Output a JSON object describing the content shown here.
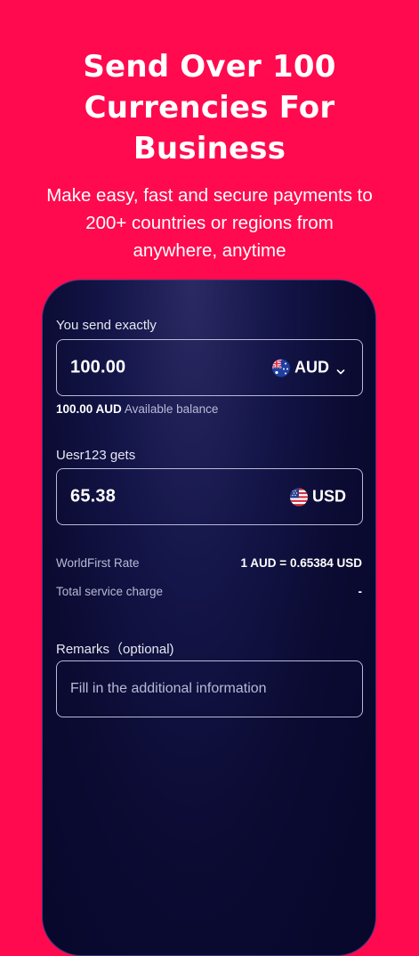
{
  "headline": {
    "line1": "Send Over 100",
    "line2": "Currencies For",
    "line3": "Business"
  },
  "subhead": {
    "line1": "Make easy, fast and secure payments to",
    "line2": "200+ countries or regions from",
    "line3": "anywhere, anytime"
  },
  "send": {
    "label": "You send exactly",
    "amount": "100.00",
    "currency": "AUD",
    "flag_icon": "australia-flag-icon",
    "balance_amount": "100.00 AUD",
    "balance_text": "Available balance"
  },
  "receive": {
    "label": "Uesr123 gets",
    "amount": "65.38",
    "currency": "USD",
    "flag_icon": "us-flag-icon"
  },
  "rate": {
    "label": "WorldFirst Rate",
    "value": "1 AUD = 0.65384 USD"
  },
  "charge": {
    "label": "Total service charge",
    "value": "-"
  },
  "remarks": {
    "label": "Remarks（optional)",
    "placeholder": "Fill in the additional information"
  },
  "colors": {
    "background": "#FF0A4E",
    "card": "#0b0b33",
    "text_primary": "#ffffff",
    "text_secondary": "#b9b9d6"
  }
}
